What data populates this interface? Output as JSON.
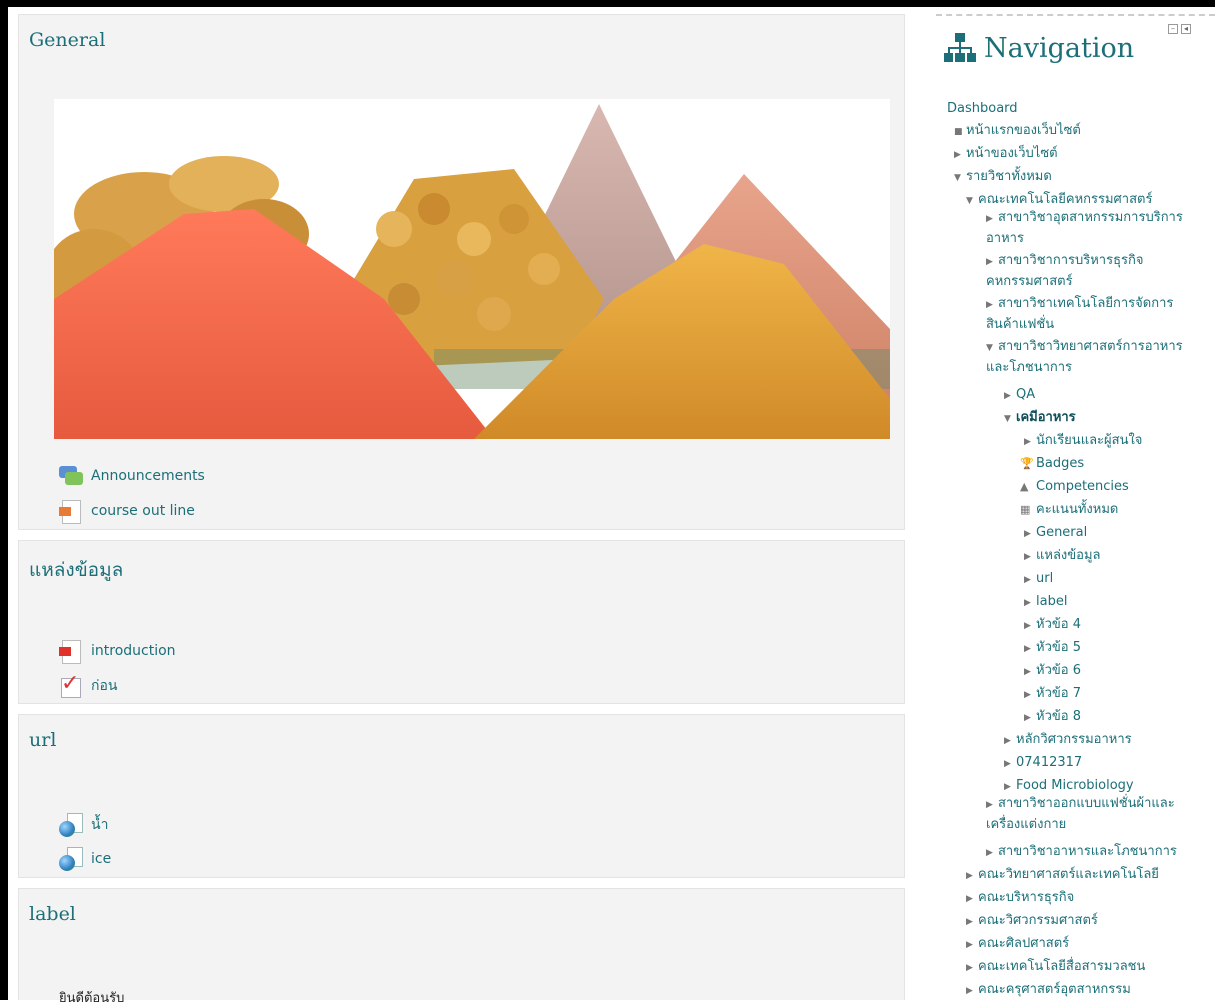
{
  "sections": [
    {
      "title": "General",
      "activities": [
        {
          "icon": "forum-icon",
          "label": "Announcements"
        },
        {
          "icon": "powerpoint-file-icon",
          "label": "course out line"
        }
      ]
    },
    {
      "title": "แหล่งข้อมูล",
      "activities": [
        {
          "icon": "pdf-file-icon",
          "label": "introduction"
        },
        {
          "icon": "quiz-check-icon",
          "label": "ก่อน"
        }
      ]
    },
    {
      "title": "url",
      "activities": [
        {
          "icon": "url-globe-icon",
          "label": "น้ำ"
        },
        {
          "icon": "url-globe-icon",
          "label": "ice"
        }
      ]
    },
    {
      "title": "label",
      "text": "ยินดีต้อนรับ"
    }
  ],
  "navigation": {
    "title": "Navigation",
    "icon": "sitemap-icon",
    "items": [
      {
        "label": "Dashboard",
        "marker": ""
      },
      {
        "label": "หน้าแรกของเว็บไซต์",
        "marker": "bullet"
      },
      {
        "label": "หน้าของเว็บไซต์",
        "marker": "collapsed"
      },
      {
        "label": "รายวิชาทั้งหมด",
        "marker": "expanded"
      },
      {
        "label": "คณะเทคโนโลยีคหกรรมศาสตร์",
        "marker": "expanded"
      },
      {
        "label": "สาขาวิชาอุตสาหกรรมการบริการอาหาร",
        "marker": "collapsed"
      },
      {
        "label": "สาขาวิชาการบริหารธุรกิจคหกรรมศาสตร์",
        "marker": "collapsed"
      },
      {
        "label": "สาขาวิชาเทคโนโลยีการจัดการสินค้าแฟชั่น",
        "marker": "collapsed"
      },
      {
        "label": "สาขาวิชาวิทยาศาสตร์การอาหารและโภชนาการ",
        "marker": "expanded"
      },
      {
        "label": "QA",
        "marker": "collapsed"
      },
      {
        "label": "เคมีอาหาร",
        "marker": "expanded"
      },
      {
        "label": "นักเรียนและผู้สนใจ",
        "marker": "collapsed"
      },
      {
        "label": "Badges",
        "marker": "trophy-icon"
      },
      {
        "label": "Competencies",
        "marker": "competency-icon"
      },
      {
        "label": "คะแนนทั้งหมด",
        "marker": "grades-table-icon"
      },
      {
        "label": "General",
        "marker": "collapsed"
      },
      {
        "label": "แหล่งข้อมูล",
        "marker": "collapsed"
      },
      {
        "label": "url",
        "marker": "collapsed"
      },
      {
        "label": "label",
        "marker": "collapsed"
      },
      {
        "label": "หัวข้อ 4",
        "marker": "collapsed"
      },
      {
        "label": "หัวข้อ 5",
        "marker": "collapsed"
      },
      {
        "label": "หัวข้อ 6",
        "marker": "collapsed"
      },
      {
        "label": "หัวข้อ 7",
        "marker": "collapsed"
      },
      {
        "label": "หัวข้อ 8",
        "marker": "collapsed"
      },
      {
        "label": "หลักวิศวกรรมอาหาร",
        "marker": "collapsed"
      },
      {
        "label": "07412317",
        "marker": "collapsed"
      },
      {
        "label": "Food Microbiology",
        "marker": "collapsed"
      },
      {
        "label": "สาขาวิชาออกแบบแฟชั่นผ้าและเครื่องแต่งกาย",
        "marker": "collapsed"
      },
      {
        "label": "สาขาวิชาอาหารและโภชนาการ",
        "marker": "collapsed"
      },
      {
        "label": "คณะวิทยาศาสตร์และเทคโนโลยี",
        "marker": "collapsed"
      },
      {
        "label": "คณะบริหารธุรกิจ",
        "marker": "collapsed"
      },
      {
        "label": "คณะวิศวกรรมศาสตร์",
        "marker": "collapsed"
      },
      {
        "label": "คณะศิลปศาสตร์",
        "marker": "collapsed"
      },
      {
        "label": "คณะเทคโนโลยีสื่อสารมวลชน",
        "marker": "collapsed"
      },
      {
        "label": "คณะครุศาสตร์อุตสาหกรรม",
        "marker": "collapsed"
      }
    ]
  },
  "colors": {
    "accent": "#1c6f78",
    "section_bg": "#f3f3f3"
  }
}
